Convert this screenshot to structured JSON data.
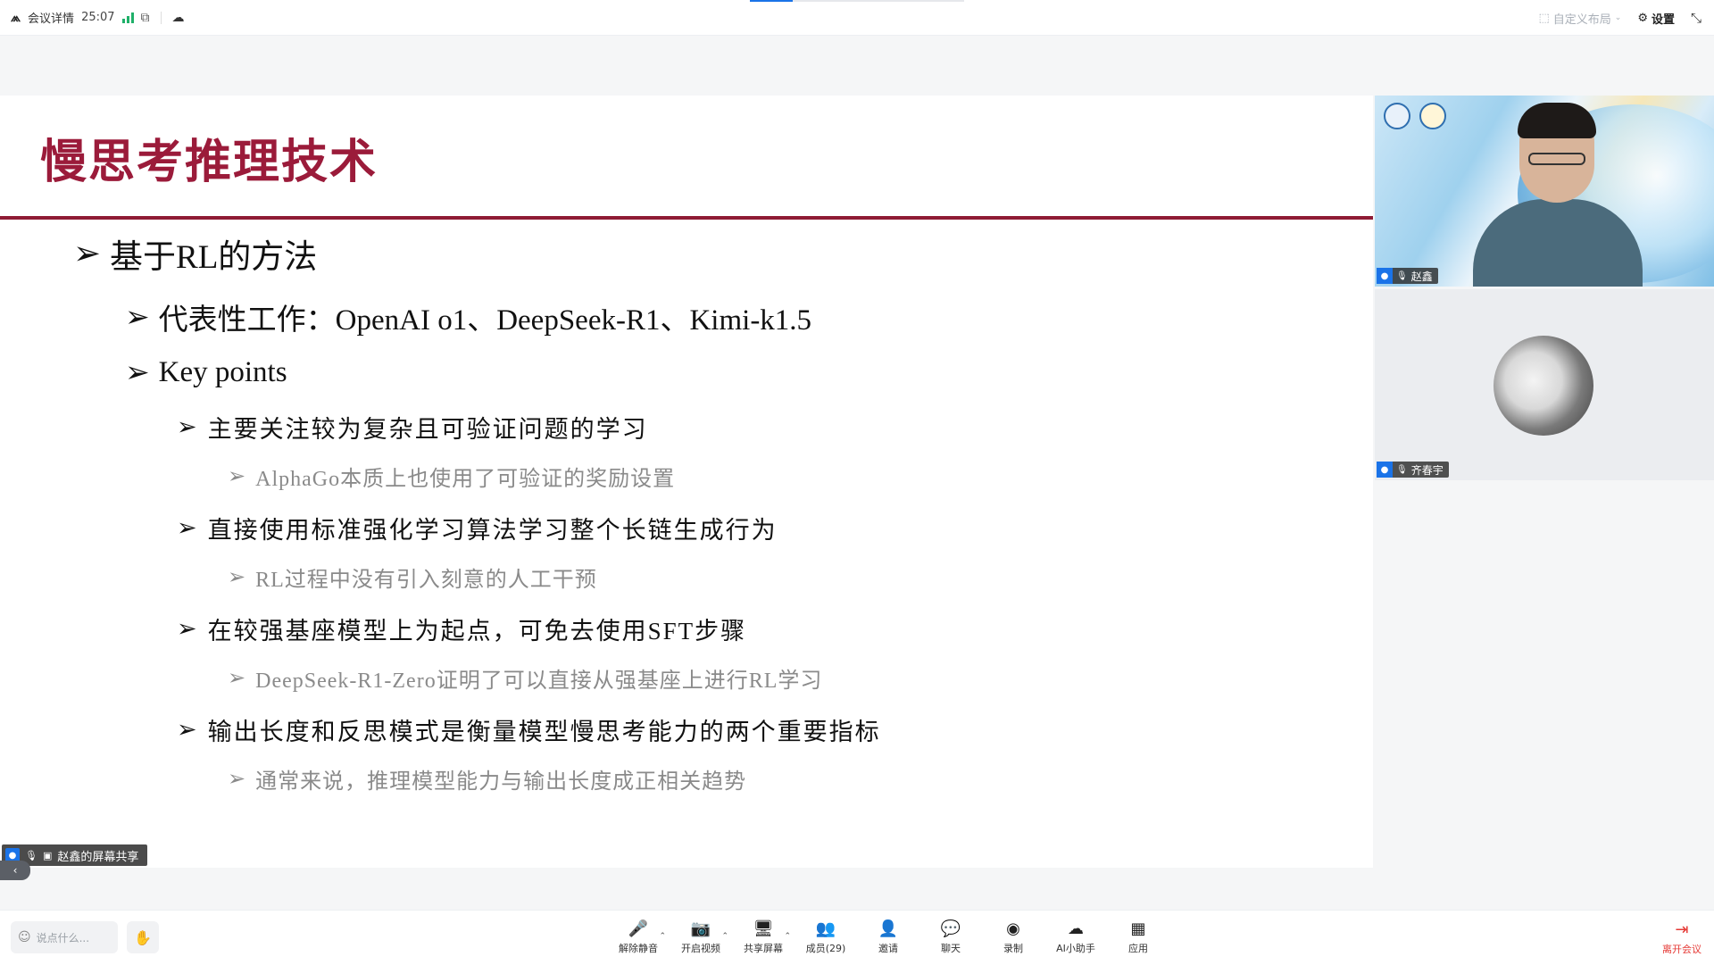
{
  "top": {
    "app_label": "会议详情",
    "timer": "25:07",
    "layout_label": "自定义布局",
    "settings_label": "设置",
    "progress": 0.2
  },
  "slide": {
    "title": "慢思考推理技术",
    "arrow": "➢",
    "bullets": [
      {
        "level": 1,
        "text": "基于RL的方法"
      },
      {
        "level": 2,
        "text": "代表性工作：OpenAI o1、DeepSeek-R1、Kimi-k1.5"
      },
      {
        "level": 2,
        "text": "Key points"
      },
      {
        "level": 3,
        "text": "主要关注较为复杂且可验证问题的学习"
      },
      {
        "level": 4,
        "text": "AlphaGo本质上也使用了可验证的奖励设置"
      },
      {
        "level": 3,
        "text": "直接使用标准强化学习算法学习整个长链生成行为"
      },
      {
        "level": 4,
        "text": "RL过程中没有引入刻意的人工干预"
      },
      {
        "level": 3,
        "text": "在较强基座模型上为起点，可免去使用SFT步骤"
      },
      {
        "level": 4,
        "text": "DeepSeek-R1-Zero证明了可以直接从强基座上进行RL学习"
      },
      {
        "level": 3,
        "text": "输出长度和反思模式是衡量模型慢思考能力的两个重要指标"
      },
      {
        "level": 4,
        "text": "通常来说，推理模型能力与输出长度成正相关趋势"
      }
    ]
  },
  "share_tag": "赵鑫的屏幕共享",
  "participants": [
    {
      "name": "赵鑫"
    },
    {
      "name": "齐春宇"
    }
  ],
  "bottom": {
    "chat_placeholder": "说点什么...",
    "controls": [
      {
        "label": "解除静音",
        "icon": "mic-off-icon",
        "glyph": "🎤",
        "caret": true
      },
      {
        "label": "开启视频",
        "icon": "camera-off-icon",
        "glyph": "📷",
        "caret": true
      },
      {
        "label": "共享屏幕",
        "icon": "share-screen-icon",
        "glyph": "🖥",
        "caret": true
      },
      {
        "label": "成员(29)",
        "icon": "members-icon",
        "glyph": "👥",
        "caret": false
      },
      {
        "label": "邀请",
        "icon": "invite-icon",
        "glyph": "👤",
        "caret": false
      },
      {
        "label": "聊天",
        "icon": "chat-icon",
        "glyph": "💬",
        "caret": false
      },
      {
        "label": "录制",
        "icon": "record-icon",
        "glyph": "◉",
        "caret": false
      },
      {
        "label": "AI小助手",
        "icon": "ai-assistant-icon",
        "glyph": "☁",
        "caret": false
      },
      {
        "label": "应用",
        "icon": "apps-icon",
        "glyph": "▦",
        "caret": false
      }
    ],
    "leave_label": "离开会议"
  },
  "colors": {
    "title": "#9b1b3a",
    "rule": "#8f1b35",
    "leave": "#e53935",
    "accent": "#1a73e8"
  }
}
